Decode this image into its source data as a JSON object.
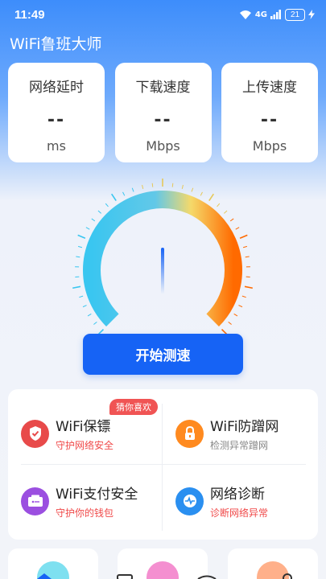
{
  "status": {
    "time": "11:49",
    "battery": "21",
    "signal": "4G"
  },
  "app": {
    "title": "WiFi鲁班大师"
  },
  "metrics": [
    {
      "label": "网络延时",
      "value": "--",
      "unit": "ms"
    },
    {
      "label": "下载速度",
      "value": "--",
      "unit": "Mbps"
    },
    {
      "label": "上传速度",
      "value": "--",
      "unit": "Mbps"
    }
  ],
  "speed_button": {
    "label": "开始测速"
  },
  "features": {
    "tag": "猜你喜欢",
    "items": [
      {
        "title": "WiFi保镖",
        "subtitle": "守护网络安全",
        "icon": "shield-check-icon",
        "color": "#e84a4a"
      },
      {
        "title": "WiFi防蹭网",
        "subtitle": "检测异常蹭网",
        "icon": "lock-icon",
        "color": "#ff8a1f"
      },
      {
        "title": "WiFi支付安全",
        "subtitle": "守护你的钱包",
        "icon": "wallet-icon",
        "color": "#9b4fe0"
      },
      {
        "title": "网络诊断",
        "subtitle": "诊断网络异常",
        "icon": "diagnosis-icon",
        "color": "#2a8ff0"
      }
    ]
  },
  "colors": {
    "accent": "#1663f5",
    "danger": "#f04a4a"
  }
}
